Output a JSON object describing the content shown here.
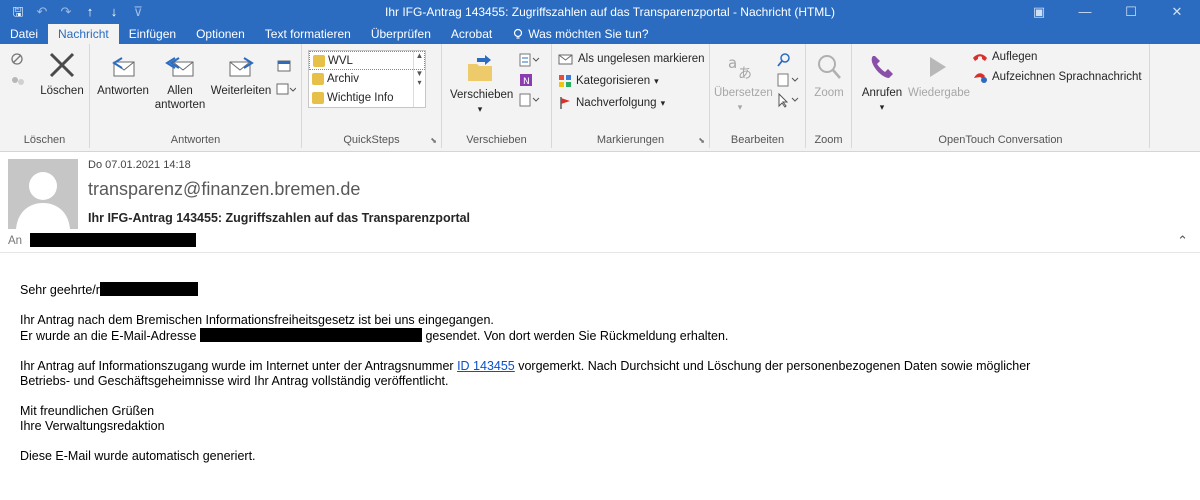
{
  "window": {
    "title": "Ihr IFG-Antrag 143455: Zugriffszahlen auf das Transparenzportal  -  Nachricht (HTML)",
    "controls": [
      "▣",
      "—",
      "☐",
      "✕"
    ]
  },
  "qat": {
    "save": "🖫",
    "undo": "↶",
    "redo": "↷",
    "up": "↑",
    "down": "↓",
    "customize": "⊽"
  },
  "tabs": [
    "Datei",
    "Nachricht",
    "Einfügen",
    "Optionen",
    "Text formatieren",
    "Überprüfen",
    "Acrobat"
  ],
  "tell_me": "Was möchten Sie tun?",
  "ribbon": {
    "loeschen": {
      "delete": "Löschen",
      "group": "Löschen"
    },
    "antworten": {
      "reply": "Antworten",
      "reply_all_1": "Allen",
      "reply_all_2": "antworten",
      "forward": "Weiterleiten",
      "group": "Antworten"
    },
    "quicksteps": {
      "items": [
        "WVL",
        "Archiv",
        "Wichtige Info"
      ],
      "group": "QuickSteps"
    },
    "verschieben": {
      "move": "Verschieben",
      "group": "Verschieben"
    },
    "markierungen": {
      "unread": "Als ungelesen markieren",
      "categorize": "Kategorisieren",
      "followup": "Nachverfolgung",
      "group": "Markierungen"
    },
    "bearbeiten": {
      "translate": "Übersetzen",
      "group": "Bearbeiten"
    },
    "zoom": {
      "zoom": "Zoom",
      "group": "Zoom"
    },
    "opentouch": {
      "call": "Anrufen",
      "play": "Wiedergabe",
      "hangup": "Auflegen",
      "record": "Aufzeichnen Sprachnachricht",
      "group": "OpenTouch Conversation"
    }
  },
  "message": {
    "date": "Do 07.01.2021 14:18",
    "sender": "transparenz@finanzen.bremen.de",
    "subject": "Ihr IFG-Antrag 143455: Zugriffszahlen auf das Transparenzportal",
    "to_label": "An"
  },
  "body": {
    "greeting": "Sehr geehrte/r",
    "p1_line1": "Ihr Antrag nach dem Bremischen Informationsfreiheitsgesetz ist bei uns eingegangen.",
    "p1_line2_a": "Er wurde an die E-Mail-Adresse",
    "p1_line2_b": "gesendet. Von dort werden Sie Rückmeldung erhalten.",
    "p2_a": "Ihr Antrag auf Informationszugang wurde im Internet unter der Antragsnummer",
    "p2_link": "ID 143455",
    "p2_b": "vorgemerkt. Nach Durchsicht und Löschung der personenbezogenen Daten sowie möglicher",
    "p2_line2": "Betriebs- und Geschäftsgeheimnisse wird Ihr Antrag vollständig veröffentlicht.",
    "closing1": "Mit freundlichen Grüßen",
    "closing2": "Ihre Verwaltungsredaktion",
    "footer": "Diese E-Mail wurde automatisch generiert."
  },
  "colors": {
    "titlebar": "#2b6cc0",
    "ribbon": "#f3f3f3",
    "link": "#0b50c8"
  }
}
